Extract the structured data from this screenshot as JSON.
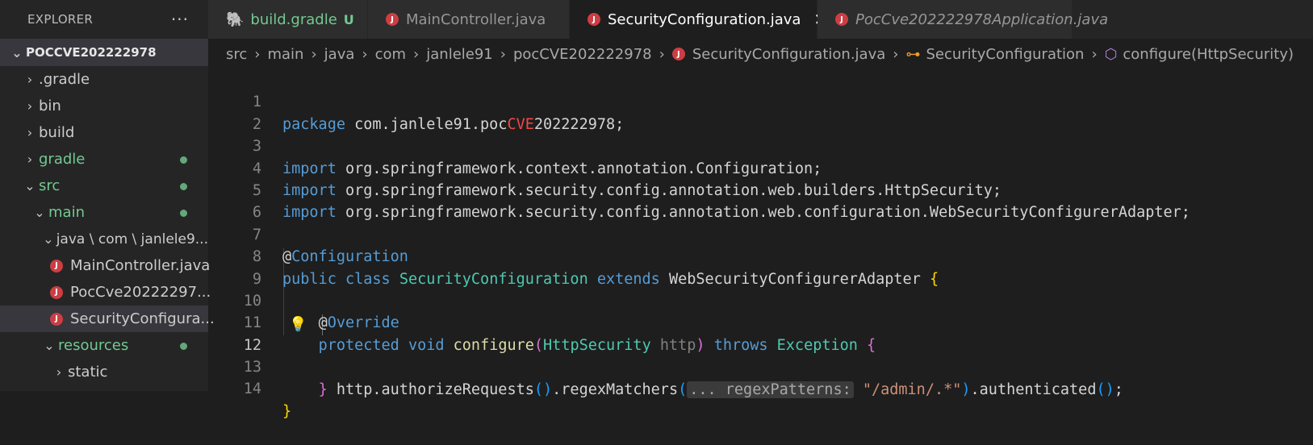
{
  "explorer": {
    "title": "EXPLORER",
    "more": "···",
    "root": "POCCVE202222978",
    "items": [
      {
        "label": ".gradle"
      },
      {
        "label": "bin"
      },
      {
        "label": "build"
      },
      {
        "label": "gradle"
      },
      {
        "label": "src"
      },
      {
        "label": "main"
      },
      {
        "label": "java \\ com \\ janlele9..."
      },
      {
        "label": "MainController.java"
      },
      {
        "label": "PocCve20222297..."
      },
      {
        "label": "SecurityConfigura..."
      },
      {
        "label": "resources"
      },
      {
        "label": "static"
      }
    ]
  },
  "tabs": [
    {
      "label": "build.gradle",
      "badge": "U"
    },
    {
      "label": "MainController.java"
    },
    {
      "label": "SecurityConfiguration.java",
      "close": "✕"
    },
    {
      "label": "PocCve202222978Application.java"
    }
  ],
  "breadcrumb": [
    "src",
    "main",
    "java",
    "com",
    "janlele91",
    "pocCVE202222978",
    "SecurityConfiguration.java",
    "SecurityConfiguration",
    "configure(HttpSecurity)"
  ],
  "editor": {
    "line_numbers": [
      "1",
      "2",
      "3",
      "4",
      "5",
      "6",
      "7",
      "8",
      "9",
      "10",
      "11",
      "12",
      "13",
      "14"
    ],
    "code": {
      "l1a": "package",
      "l1b": " com.janlele91.poc",
      "l1c": "CVE",
      "l1d": "202222978;",
      "imp": "import",
      "l3": " org.springframework.context.annotation.Configuration;",
      "l4": " org.springframework.security.config.annotation.web.builders.HttpSecurity;",
      "l5": " org.springframework.security.config.annotation.web.configuration.WebSecurityConfigurerAdapter;",
      "at": "@",
      "l7": "Configuration",
      "l8a": "public",
      "l8b": "class",
      "l8c": "SecurityConfiguration",
      "l8d": "extends",
      "l8e": "WebSecurityConfigurerAdapter",
      "l8f": "{",
      "l10": "Override",
      "l11a": "protected",
      "l11b": "void",
      "l11c": "configure",
      "l11d": "(",
      "l11e": "HttpSecurity",
      "l11f": "http",
      "l11g": ")",
      "l11h": "throws",
      "l11i": "Exception",
      "l11j": "{",
      "l12a": "http.authorizeRequests",
      "l12b": "()",
      "l12c": ".regexMatchers",
      "l12d": "(",
      "l12hint": "... regexPatterns:",
      "l12e": "\"/admin/.*\"",
      "l12f": ")",
      "l12g": ".authenticated",
      "l12h": "()",
      "l12i": ";",
      "l13": "}",
      "l14": "}"
    }
  },
  "colors": {
    "accent": "#73c991",
    "java_icon": "#cc3e44",
    "bulb": "#ffcc00"
  }
}
